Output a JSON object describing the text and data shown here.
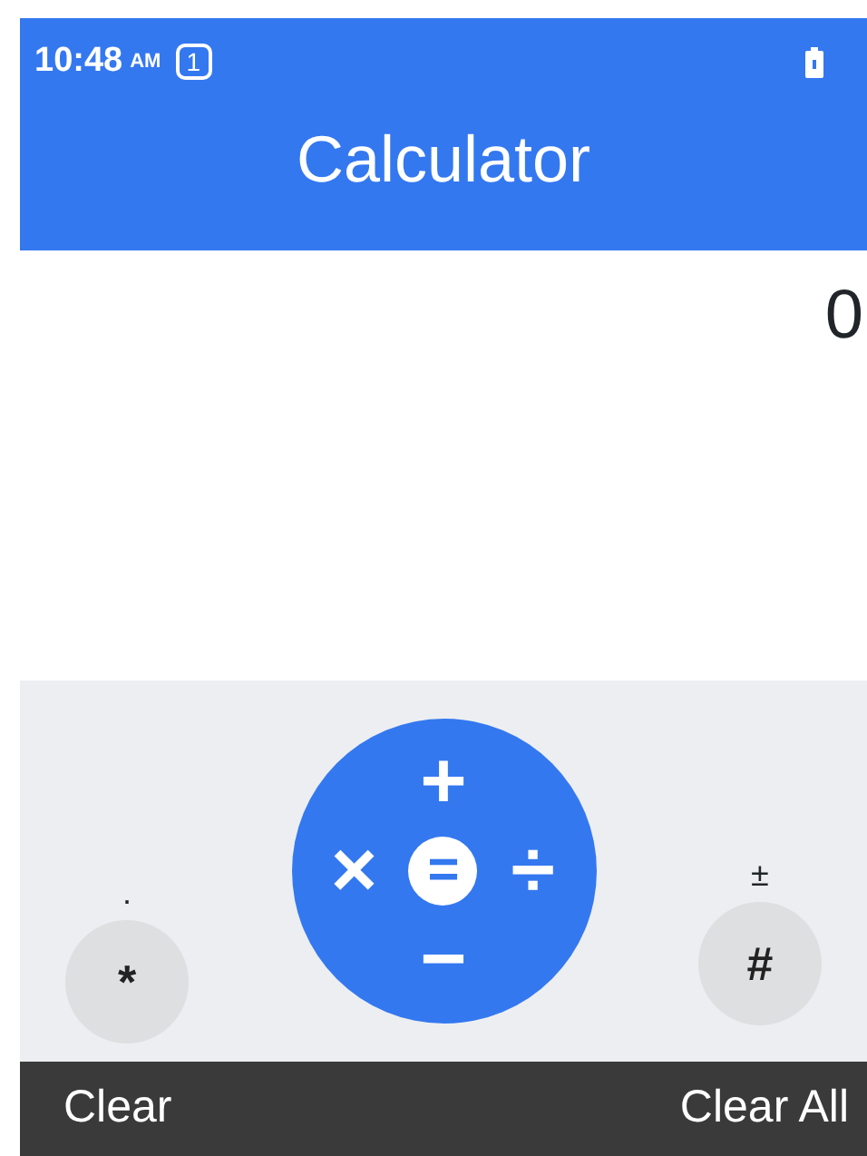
{
  "status_bar": {
    "time": "10:48",
    "meridiem": "AM",
    "notification_count": "1"
  },
  "title": "Calculator",
  "display": {
    "value": "0"
  },
  "keypad": {
    "left_key": {
      "hint": ".",
      "label": "*"
    },
    "operators": [
      {
        "kind": "top",
        "label": "+"
      },
      {
        "kind": "left",
        "label": "×"
      },
      {
        "kind": "center",
        "label": "="
      },
      {
        "kind": "right",
        "label": "÷"
      },
      {
        "kind": "bottom",
        "label": "−"
      }
    ],
    "right_key": {
      "hint": "±",
      "label": "#"
    }
  },
  "softkeys": [
    {
      "label": "Clear"
    },
    {
      "label": "Clear All"
    }
  ]
}
